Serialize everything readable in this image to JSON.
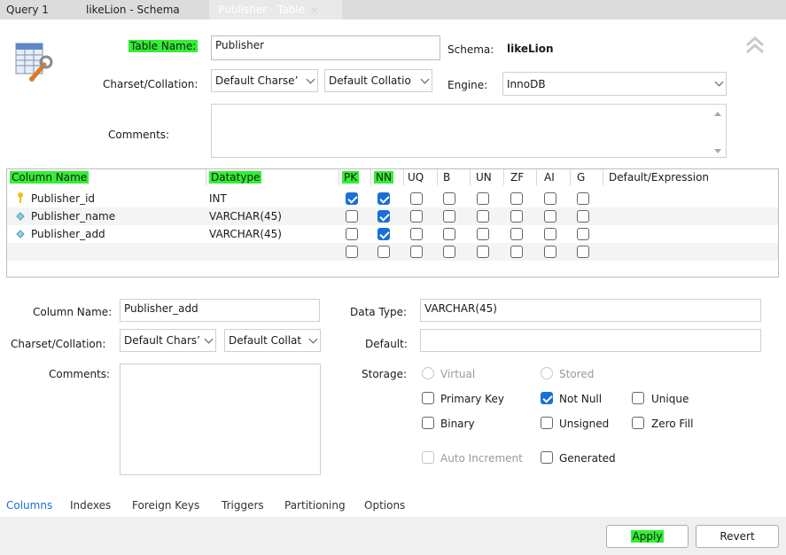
{
  "tabs": [
    {
      "label": "Query 1"
    },
    {
      "label": "likeLion - Schema"
    },
    {
      "label": "Publisher - Table",
      "close": "×"
    }
  ],
  "table": {
    "name_label": "Table Name:",
    "name_value": "Publisher",
    "schema_label": "Schema:",
    "schema_value": "likeLion",
    "charset_label": "Charset/Collation:",
    "charset_value": "Default Charse’",
    "collation_value": "Default Collatio",
    "engine_label": "Engine:",
    "engine_value": "InnoDB",
    "comments_label": "Comments:"
  },
  "columns_grid": {
    "headers": [
      "Column Name",
      "Datatype",
      "PK",
      "NN",
      "UQ",
      "B",
      "UN",
      "ZF",
      "AI",
      "G",
      "Default/Expression"
    ],
    "highlighted_headers": [
      "Column Name",
      "Datatype",
      "PK",
      "NN"
    ],
    "rows": [
      {
        "icon": "key-icon",
        "name": "Publisher_id",
        "type": "INT",
        "flags": [
          true,
          true,
          false,
          false,
          false,
          false,
          false,
          false
        ]
      },
      {
        "icon": "diamond-icon",
        "name": "Publisher_name",
        "type": "VARCHAR(45)",
        "flags": [
          false,
          true,
          false,
          false,
          false,
          false,
          false,
          false
        ]
      },
      {
        "icon": "diamond-icon",
        "name": "Publisher_add",
        "type": "VARCHAR(45)",
        "flags": [
          false,
          true,
          false,
          false,
          false,
          false,
          false,
          false
        ]
      },
      {
        "icon": "",
        "name": "",
        "type": "",
        "flags": [
          false,
          false,
          false,
          false,
          false,
          false,
          false,
          false
        ]
      }
    ]
  },
  "details": {
    "column_name_label": "Column Name:",
    "column_name_value": "Publisher_add",
    "charset_label": "Charset/Collation:",
    "charset_value": "Default Chars’",
    "collation_value": "Default Collat",
    "comments_label": "Comments:",
    "data_type_label": "Data Type:",
    "data_type_value": "VARCHAR(45)",
    "default_label": "Default:",
    "default_value": "",
    "storage_label": "Storage:",
    "virtual_label": "Virtual",
    "stored_label": "Stored",
    "primary_key_label": "Primary Key",
    "not_null_label": "Not Null",
    "unique_label": "Unique",
    "binary_label": "Binary",
    "unsigned_label": "Unsigned",
    "zero_fill_label": "Zero Fill",
    "auto_increment_label": "Auto Increment",
    "generated_label": "Generated",
    "not_null_checked": true
  },
  "bottom_tabs": [
    "Columns",
    "Indexes",
    "Foreign Keys",
    "Triggers",
    "Partitioning",
    "Options"
  ],
  "buttons": {
    "apply": "Apply",
    "revert": "Revert"
  },
  "colors": {
    "highlight": "#33ee33",
    "accent": "#1a6fd8"
  }
}
